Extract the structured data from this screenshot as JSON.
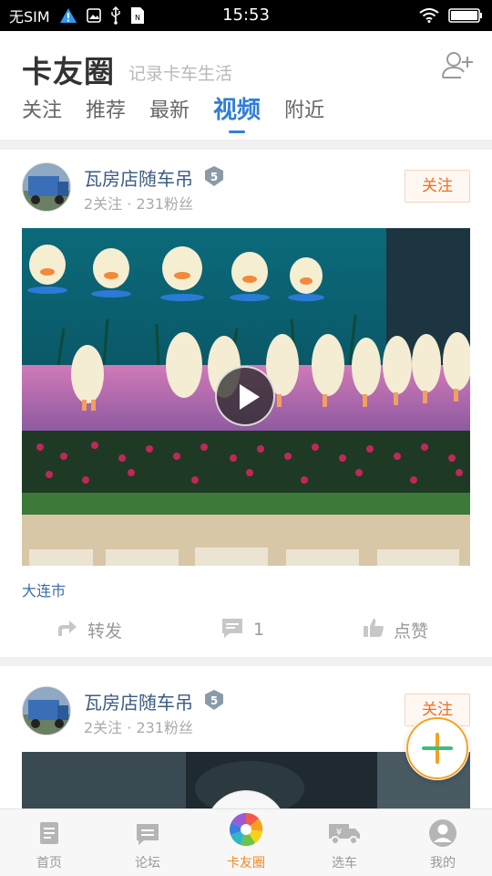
{
  "status_bar": {
    "carrier": "无SIM",
    "time": "15:53",
    "icons": [
      "warning-icon",
      "photo-icon",
      "usb-icon",
      "sim-icon",
      "wifi-icon",
      "battery-icon"
    ]
  },
  "header": {
    "title": "卡友圈",
    "subtitle": "记录卡车生活",
    "add_friend_icon": "add-user-icon",
    "tabs": [
      {
        "label": "关注",
        "active": false
      },
      {
        "label": "推荐",
        "active": false
      },
      {
        "label": "最新",
        "active": false
      },
      {
        "label": "视频",
        "active": true
      },
      {
        "label": "附近",
        "active": false
      }
    ]
  },
  "posts": [
    {
      "username": "瓦房店随车吊",
      "badge": "5",
      "stats": "2关注 · 231粉丝",
      "follow_label": "关注",
      "location": "大连市",
      "actions": {
        "share": "转发",
        "comments": "1",
        "like": "点赞"
      }
    },
    {
      "username": "瓦房店随车吊",
      "badge": "5",
      "stats": "2关注 · 231粉丝",
      "follow_label": "关注"
    }
  ],
  "bottom_nav": [
    {
      "label": "首页",
      "icon": "home-icon",
      "active": false
    },
    {
      "label": "论坛",
      "icon": "forum-icon",
      "active": false
    },
    {
      "label": "卡友圈",
      "icon": "pinwheel-icon",
      "active": true
    },
    {
      "label": "选车",
      "icon": "truck-icon",
      "active": false
    },
    {
      "label": "我的",
      "icon": "profile-icon",
      "active": false
    }
  ],
  "colors": {
    "accent_blue": "#2f7ed8",
    "follow_orange": "#f26d1f",
    "nav_active": "#f08a1c"
  }
}
